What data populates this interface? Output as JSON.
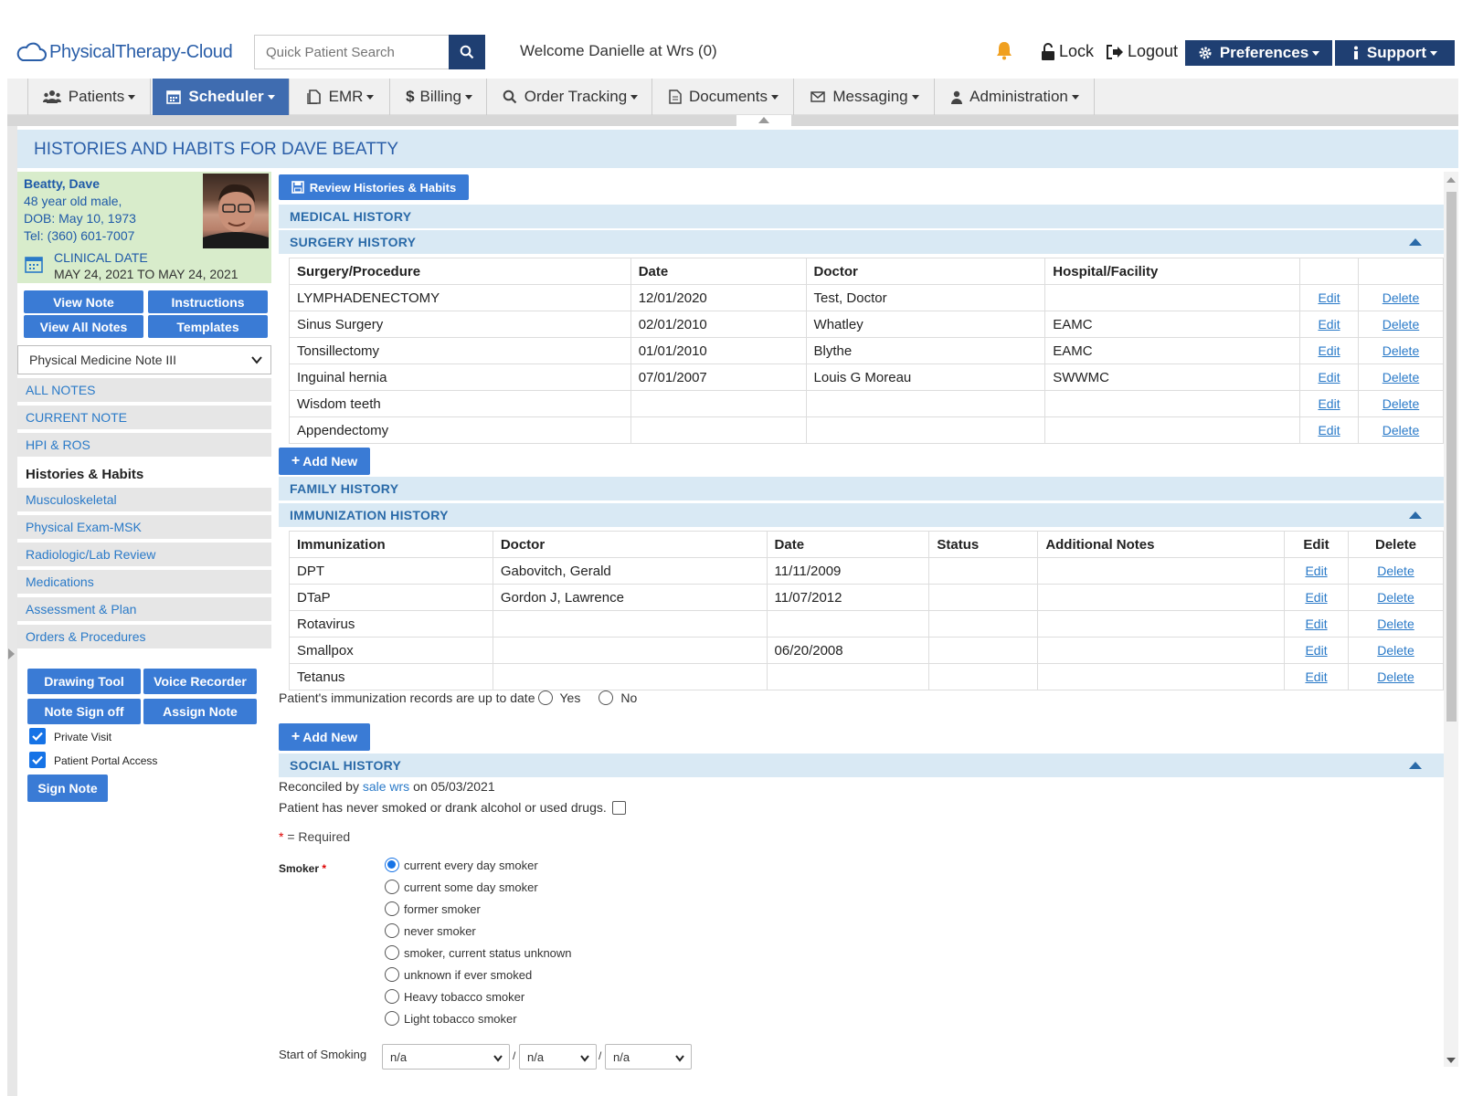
{
  "app": {
    "logo_text": "PhysicalTherapy-Cloud",
    "search_placeholder": "Quick Patient Search",
    "welcome": "Welcome Danielle at Wrs (0)",
    "lock_label": "Lock",
    "logout_label": "Logout",
    "preferences_label": "Preferences",
    "support_label": "Support"
  },
  "nav": [
    {
      "label": "Patients",
      "icon": "users-icon"
    },
    {
      "label": "Scheduler",
      "icon": "calendar-icon",
      "active": true
    },
    {
      "label": "EMR",
      "icon": "file-icon"
    },
    {
      "label": "Billing",
      "icon": "dollar-icon"
    },
    {
      "label": "Order Tracking",
      "icon": "search-icon"
    },
    {
      "label": "Documents",
      "icon": "document-icon"
    },
    {
      "label": "Messaging",
      "icon": "envelope-icon"
    },
    {
      "label": "Administration",
      "icon": "user-icon"
    }
  ],
  "page_title": "HISTORIES AND HABITS FOR DAVE BEATTY",
  "patient": {
    "name": "Beatty, Dave",
    "age_sex": "48 year old male,",
    "dob": "DOB: May 10, 1973",
    "tel": "Tel: (360) 601-7007",
    "clinical_date_label": "CLINICAL DATE",
    "clinical_date_value": "MAY 24, 2021 TO MAY 24, 2021"
  },
  "sidebar": {
    "buttons": {
      "view_note": "View Note",
      "instructions": "Instructions",
      "view_all_notes": "View All Notes",
      "templates": "Templates"
    },
    "note_type": "Physical Medicine Note III",
    "items": [
      {
        "label": "ALL NOTES"
      },
      {
        "label": "CURRENT NOTE"
      },
      {
        "label": "HPI & ROS"
      },
      {
        "label": "Histories & Habits",
        "active": true
      },
      {
        "label": "Musculoskeletal"
      },
      {
        "label": "Physical Exam-MSK"
      },
      {
        "label": "Radiologic/Lab Review"
      },
      {
        "label": "Medications"
      },
      {
        "label": "Assessment & Plan"
      },
      {
        "label": "Orders & Procedures"
      }
    ],
    "tools": {
      "drawing_tool": "Drawing Tool",
      "voice_recorder": "Voice Recorder",
      "note_sign_off": "Note Sign off",
      "assign_note": "Assign Note",
      "sign_note": "Sign Note"
    },
    "checks": {
      "private_visit": "Private Visit",
      "portal_access": "Patient Portal Access"
    }
  },
  "main": {
    "review_button": "Review Histories & Habits",
    "medical_history": "MEDICAL HISTORY",
    "surgery_history": "SURGERY HISTORY",
    "surgery_headers": [
      "Surgery/Procedure",
      "Date",
      "Doctor",
      "Hospital/Facility"
    ],
    "surgery_rows": [
      [
        "LYMPHADENECTOMY",
        "12/01/2020",
        "Test, Doctor",
        ""
      ],
      [
        "Sinus Surgery",
        "02/01/2010",
        "Whatley",
        "EAMC"
      ],
      [
        "Tonsillectomy",
        "01/01/2010",
        "Blythe",
        "EAMC"
      ],
      [
        "Inguinal hernia",
        "07/01/2007",
        "Louis G Moreau",
        "SWWMC"
      ],
      [
        "Wisdom teeth",
        "",
        "",
        ""
      ],
      [
        "Appendectomy",
        "",
        "",
        ""
      ]
    ],
    "edit_label": "Edit",
    "delete_label": "Delete",
    "add_new": "Add New",
    "family_history": "FAMILY HISTORY",
    "immunization_history": "IMMUNIZATION HISTORY",
    "immunization_headers": [
      "Immunization",
      "Doctor",
      "Date",
      "Status",
      "Additional Notes",
      "Edit",
      "Delete"
    ],
    "immunization_rows": [
      [
        "DPT",
        "Gabovitch, Gerald",
        "11/11/2009",
        "",
        ""
      ],
      [
        "DTaP",
        "Gordon J, Lawrence",
        "11/07/2012",
        "",
        ""
      ],
      [
        "Rotavirus",
        "",
        "",
        "",
        ""
      ],
      [
        "Smallpox",
        "",
        "06/20/2008",
        "",
        ""
      ],
      [
        "Tetanus",
        "",
        "",
        "",
        ""
      ]
    ],
    "immunization_uptodate": "Patient's immunization records are up to date",
    "yes": "Yes",
    "no": "No",
    "social_history": "SOCIAL HISTORY",
    "reconciled_prefix": "Reconciled by",
    "reconciled_by": "sale wrs",
    "reconciled_suffix": "on 05/03/2021",
    "never_smoked": "Patient has never smoked or drank alcohol or used drugs.",
    "required_star": "*",
    "required_note": "= Required",
    "smoker_label": "Smoker",
    "smoker_options": [
      "current every day smoker",
      "current some day smoker",
      "former smoker",
      "never smoker",
      "smoker, current status unknown",
      "unknown if ever smoked",
      "Heavy tobacco smoker",
      "Light tobacco smoker"
    ],
    "smoker_selected": 0,
    "start_of_smoking": "Start of Smoking",
    "start_values": [
      "n/a",
      "n/a",
      "n/a"
    ],
    "slash": "/"
  },
  "colors": {
    "brand_dark": "#1f3f72",
    "button_blue": "#3a7bd5",
    "link_blue": "#2a7ac8",
    "section_bg": "#d9e9f4",
    "patient_card_bg": "#d8eccb",
    "bell_orange": "#f0a020"
  }
}
